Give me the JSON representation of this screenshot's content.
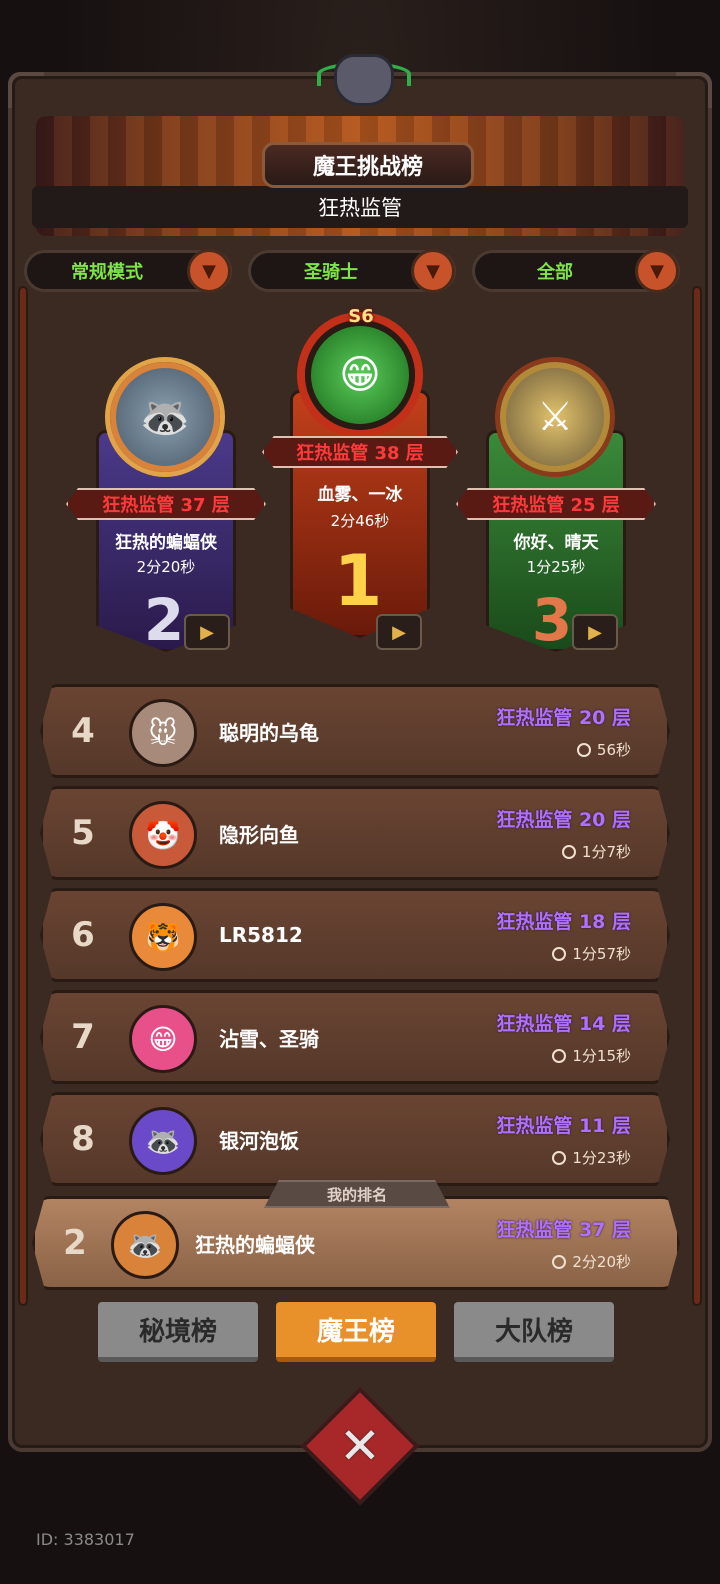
{
  "header": {
    "title": "魔王挑战榜",
    "subtitle": "狂热监管"
  },
  "filters": [
    {
      "label": "常规模式"
    },
    {
      "label": "圣骑士"
    },
    {
      "label": "全部"
    }
  ],
  "podium": {
    "season": "S6",
    "first": {
      "layer": "狂热监管 38 层",
      "name": "血雾、一冰",
      "time": "2分46秒",
      "rank": "1"
    },
    "second": {
      "layer": "狂热监管 37 层",
      "name": "狂热的蝙蝠侠",
      "time": "2分20秒",
      "rank": "2"
    },
    "third": {
      "layer": "狂热监管 25 层",
      "name": "你好、晴天",
      "time": "1分25秒",
      "rank": "3"
    }
  },
  "list": [
    {
      "rank": "4",
      "name": "聪明的乌龟",
      "layer": "狂热监管 20 层",
      "time": "56秒"
    },
    {
      "rank": "5",
      "name": "隐形向鱼",
      "layer": "狂热监管 20 层",
      "time": "1分7秒"
    },
    {
      "rank": "6",
      "name": "LR5812",
      "layer": "狂热监管 18 层",
      "time": "1分57秒"
    },
    {
      "rank": "7",
      "name": "沾雪、圣骑",
      "layer": "狂热监管 14 层",
      "time": "1分15秒"
    },
    {
      "rank": "8",
      "name": "银河泡饭",
      "layer": "狂热监管 11 层",
      "time": "1分23秒"
    }
  ],
  "my_rank": {
    "tag": "我的排名",
    "rank": "2",
    "name": "狂热的蝙蝠侠",
    "layer": "狂热监管 37 层",
    "time": "2分20秒"
  },
  "tabs": [
    {
      "label": "秘境榜"
    },
    {
      "label": "魔王榜"
    },
    {
      "label": "大队榜"
    }
  ],
  "close_glyph": "✕",
  "footer": {
    "id": "ID: 3383017"
  },
  "icons": {
    "dropdown": "▼",
    "video": "▶",
    "clock": "clock-icon"
  },
  "colors": {
    "accent_green": "#7fe34a",
    "layer_red": "#ff3a3a",
    "layer_purple": "#b070ff",
    "tab_active": "#e8902a"
  }
}
